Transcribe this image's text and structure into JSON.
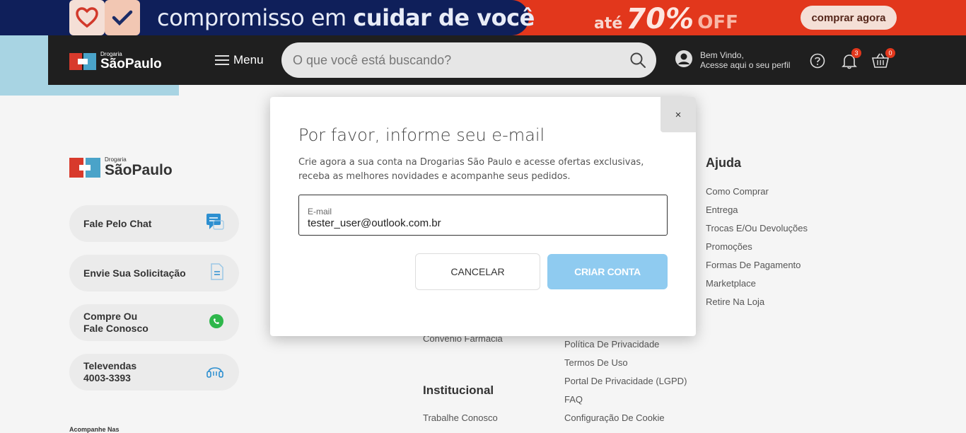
{
  "promo": {
    "tagline_regular": "compromisso em ",
    "tagline_bold": "cuidar de você",
    "discount_prefix": "até",
    "discount_value": "70%",
    "discount_suffix": "OFF",
    "cta_label": "comprar agora"
  },
  "header": {
    "logo_small": "Drogaria",
    "logo_big": "SãoPaulo",
    "menu_label": "Menu",
    "search_placeholder": "O que você está buscando?",
    "user_line1": "Bem Vindo,",
    "user_line2": "Acesse aqui o seu perfil",
    "notifications_count": "3",
    "cart_count": "0"
  },
  "footer": {
    "logo_small": "Drogaria",
    "logo_big": "SãoPaulo",
    "contacts": [
      {
        "line1": "Fale Pelo Chat",
        "line2": ""
      },
      {
        "line1": "Envie Sua Solicitação",
        "line2": ""
      },
      {
        "line1": "Compre Ou",
        "line2": "Fale Conosco"
      },
      {
        "line1": "Televendas",
        "line2": "4003-3393"
      }
    ],
    "follow_label": "Acompanhe Nas",
    "help_title": "Ajuda",
    "help_links": [
      "Como Comprar",
      "Entrega",
      "Trocas E/Ou Devoluções",
      "Promoções",
      "Formas De Pagamento",
      "Marketplace",
      "Retire Na Loja"
    ],
    "middle_links": [
      "Política De Privacidade",
      "Termos De Uso",
      "Portal De Privacidade (LGPD)",
      "FAQ",
      "Configuração De Cookie"
    ],
    "convenio_link": "Convênio Farmácia",
    "institucional_title": "Institucional",
    "institucional_links": [
      "Trabalhe Conosco"
    ]
  },
  "modal": {
    "close_label": "×",
    "title": "Por favor, informe seu e-mail",
    "description": "Crie agora a sua conta na Drogarias São Paulo e acesse ofertas exclusivas, receba as melhores novidades e acompanhe seus pedidos.",
    "email_label": "E-mail",
    "email_value": "tester_user@outlook.com.br",
    "cancel_label": "CANCELAR",
    "create_label": "CRIAR CONTA"
  }
}
